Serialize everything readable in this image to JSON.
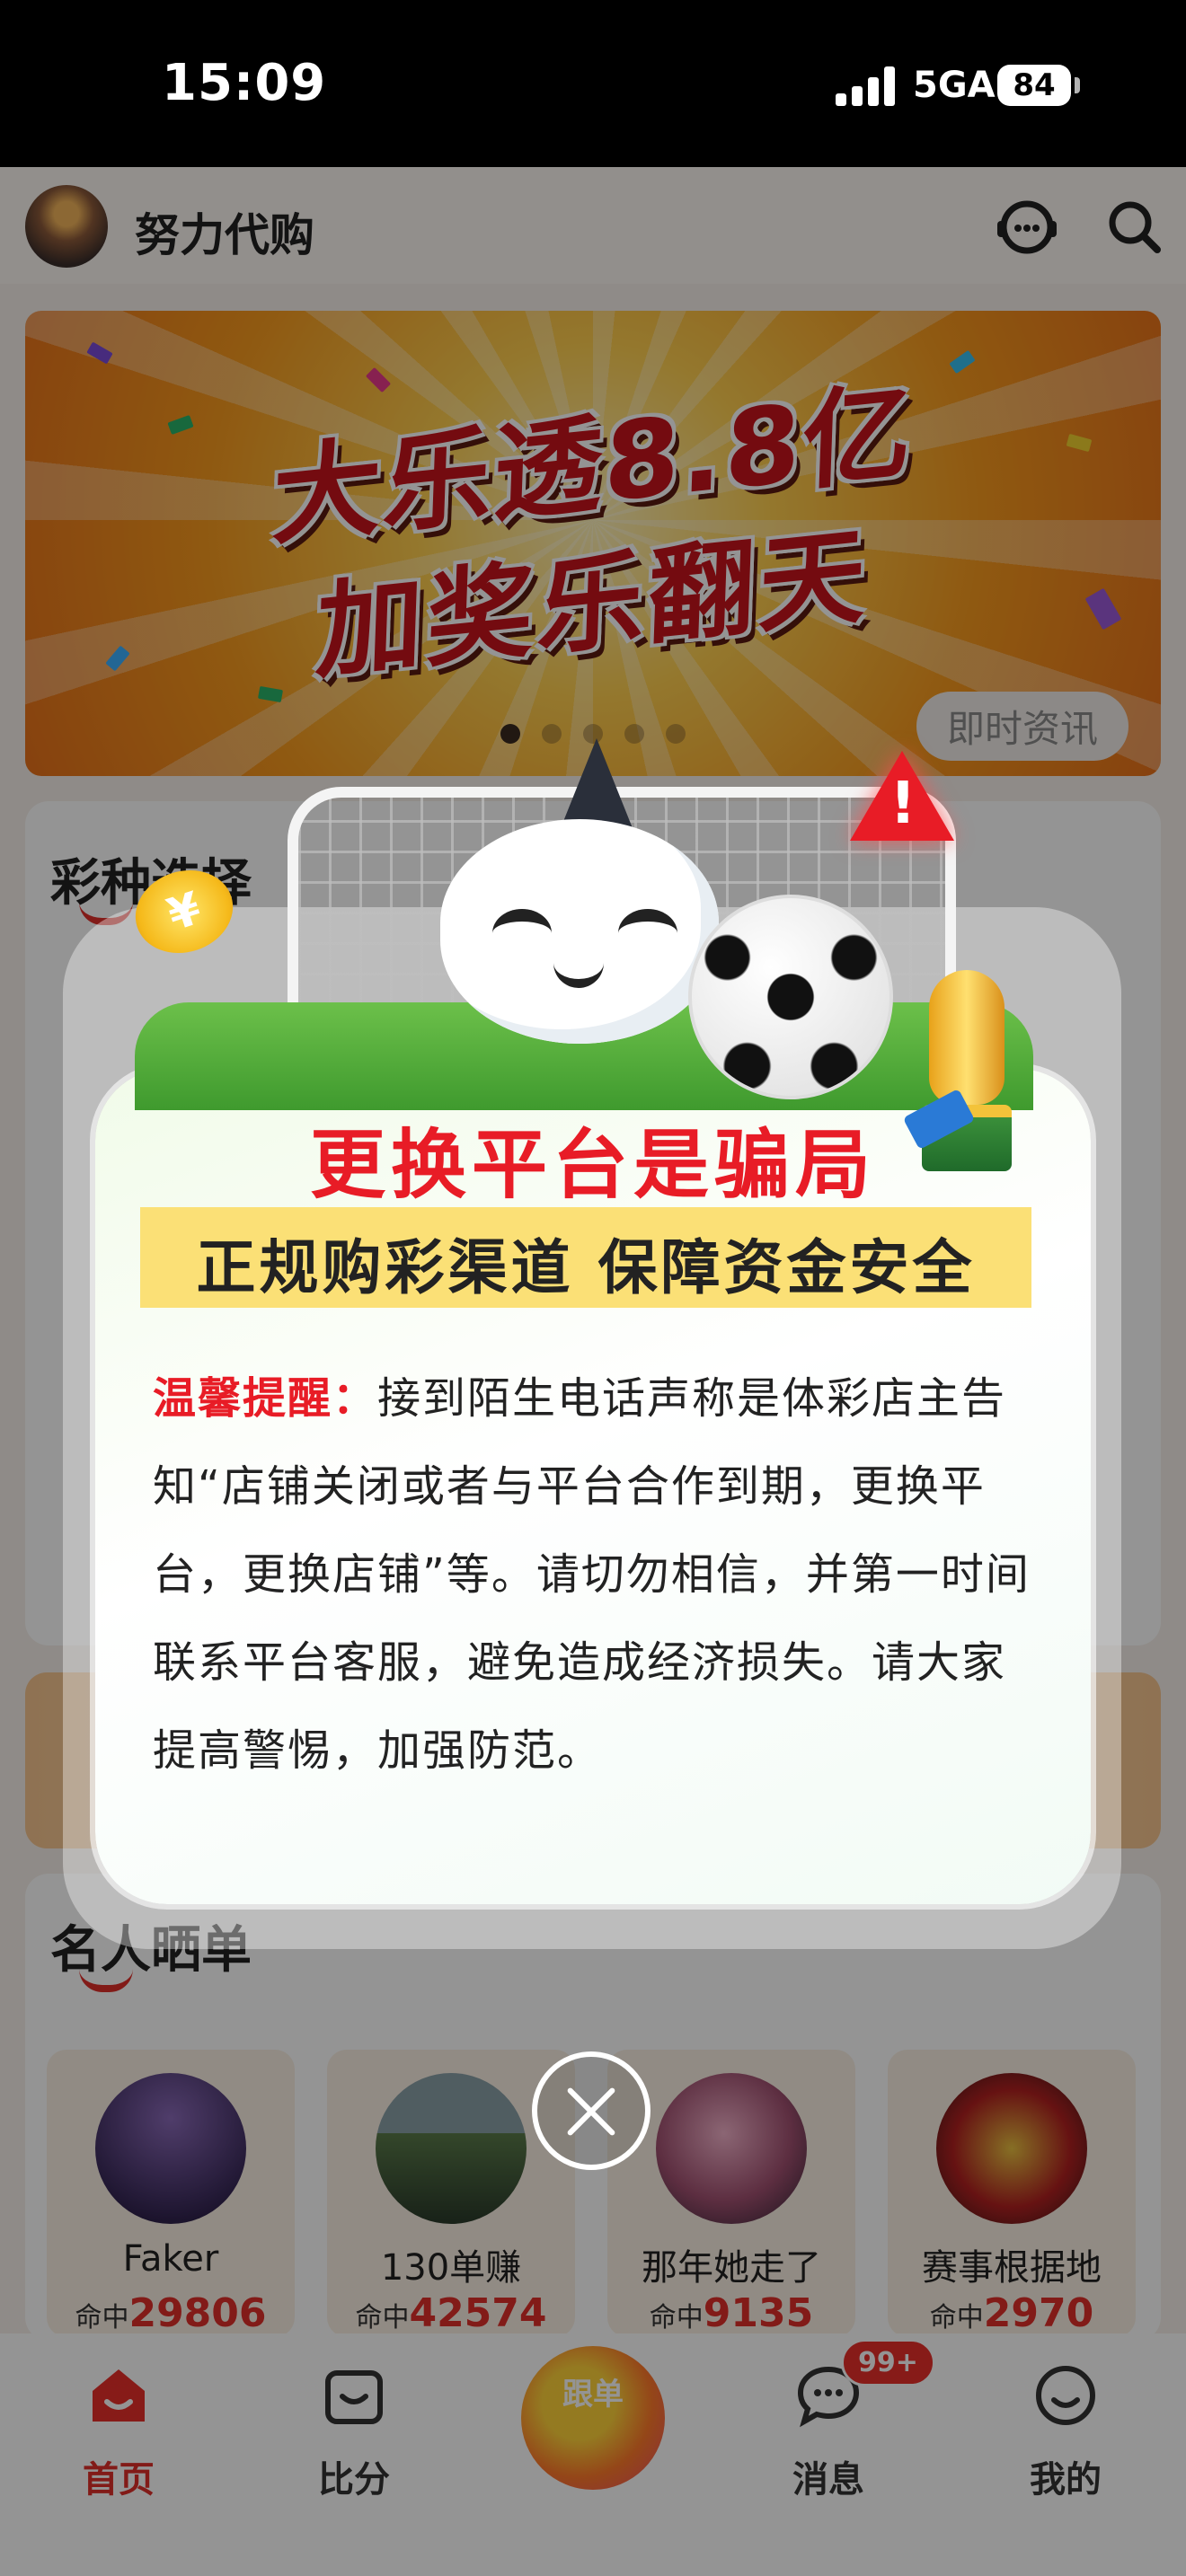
{
  "status_bar": {
    "time": "15:09",
    "network": "5GA",
    "battery": "84"
  },
  "header": {
    "store_name": "努力代购"
  },
  "banner": {
    "line1": "大乐透8.8亿",
    "line2": "加奖乐翻天",
    "slide_count": 5,
    "active_slide": 0
  },
  "lottery_section": {
    "title": "彩种选择",
    "news_tab": "即时资讯"
  },
  "celebrity_section": {
    "title": "名人晒单",
    "items": [
      {
        "name": "Faker",
        "hit_label": "命中",
        "hit_value": "29806"
      },
      {
        "name": "130单赚",
        "hit_label": "命中",
        "hit_value": "42574"
      },
      {
        "name": "那年她走了",
        "hit_label": "命中",
        "hit_value": "9135"
      },
      {
        "name": "赛事根据地",
        "hit_label": "命中",
        "hit_value": "2970"
      }
    ]
  },
  "tabbar": {
    "items": [
      {
        "label": "首页",
        "icon": "home-icon",
        "active": true
      },
      {
        "label": "比分",
        "icon": "score-icon",
        "active": false
      },
      {
        "label": "跟单",
        "icon": "follow-order-icon",
        "active": false
      },
      {
        "label": "消息",
        "icon": "message-icon",
        "active": false
      },
      {
        "label": "我的",
        "icon": "profile-icon",
        "active": false
      }
    ],
    "message_badge": "99+"
  },
  "modal": {
    "title": "更换平台是骗局",
    "subtitle": "正规购彩渠道 保障资金安全",
    "lead": "温馨提醒：",
    "body": "接到陌生电话声称是体彩店主告知“店铺关闭或者与平台合作到期，更换平台，更换店铺”等。请切勿相信，并第一时间联系平台客服，避免造成经济损失。请大家提高警惕，加强防范。",
    "coin_symbol": "¥",
    "warning_symbol": "!"
  },
  "colors": {
    "accent_red": "#e81c26",
    "highlight_yellow": "#fbe076",
    "status_bar_bg": "#000000"
  }
}
